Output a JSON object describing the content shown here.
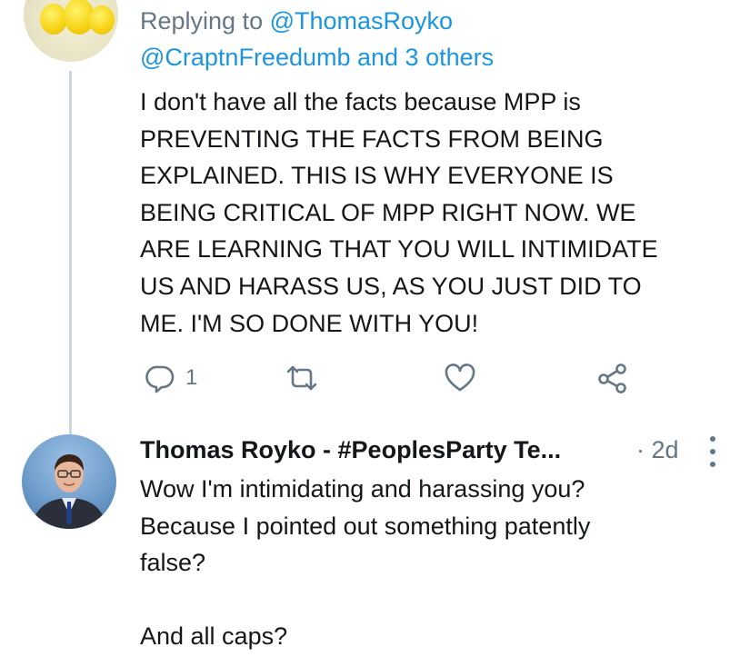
{
  "tweet": {
    "replying_prefix": "Replying to ",
    "replying_handle": "@ThomasRoyko",
    "mentions": "@CraptnFreedumb and 3 others",
    "body_lines": [
      "I don't have all the facts because MPP is",
      "PREVENTING THE FACTS FROM BEING",
      "EXPLAINED. THIS IS WHY EVERYONE IS",
      "BEING CRITICAL OF MPP RIGHT NOW. WE",
      "ARE LEARNING THAT YOU WILL INTIMIDATE",
      "US AND HARASS US, AS YOU JUST DID TO",
      "ME. I'M SO DONE WITH YOU!"
    ],
    "reply_count": "1",
    "icons": {
      "reply": "reply-icon",
      "retweet": "retweet-icon",
      "like": "like-icon",
      "share": "share-icon"
    }
  },
  "reply": {
    "author": "Thomas Royko - #PeoplesParty Te...",
    "time": "· 2d",
    "body_lines": [
      "Wow I'm intimidating and harassing you?",
      "Because I pointed out something patently",
      "false?",
      "",
      "And all caps?"
    ]
  },
  "colors": {
    "link": "#1b95e0",
    "muted": "#657786",
    "text": "#14171a",
    "thread_line": "#ccd6dd"
  }
}
